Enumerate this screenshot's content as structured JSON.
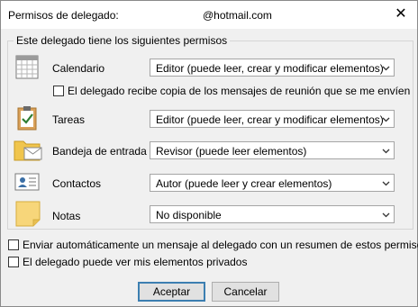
{
  "window": {
    "title": "Permisos de delegado:",
    "email": "@hotmail.com",
    "close_glyph": "✕"
  },
  "permissions": {
    "legend": "Este delegado tiene los siguientes permisos",
    "rows": [
      {
        "label": "Calendario",
        "value": "Editor (puede leer, crear y modificar elementos)",
        "icon": "calendar-icon"
      },
      {
        "label": "Tareas",
        "value": "Editor (puede leer, crear y modificar elementos)",
        "icon": "tasks-clipboard-icon"
      },
      {
        "label": "Bandeja de entrada",
        "value": "Revisor (puede leer elementos)",
        "icon": "inbox-folder-icon"
      },
      {
        "label": "Contactos",
        "value": "Autor (puede leer y crear elementos)",
        "icon": "contact-card-icon"
      },
      {
        "label": "Notas",
        "value": "No disponible",
        "icon": "sticky-note-icon"
      }
    ],
    "meeting_copy_checkbox": {
      "label": "El delegado recibe copia de los mensajes de reunión que se me envíen",
      "checked": false
    }
  },
  "options": {
    "auto_message": {
      "label": "Enviar automáticamente un mensaje al delegado con un resumen de estos permisos",
      "checked": false
    },
    "private_items": {
      "label": "El delegado puede ver mis elementos privados",
      "checked": false
    }
  },
  "buttons": {
    "accept": "Aceptar",
    "cancel": "Cancelar"
  },
  "colors": {
    "default_button_border": "#3c7fb1",
    "dialog_background": "#f0f0f0"
  }
}
